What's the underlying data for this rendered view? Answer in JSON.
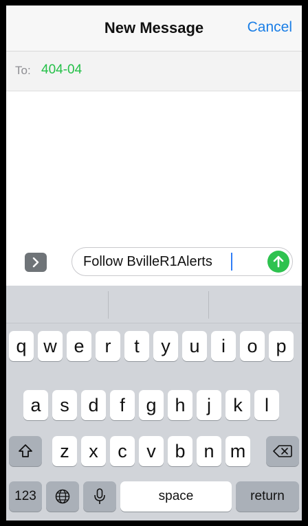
{
  "header": {
    "title": "New Message",
    "cancel_label": "Cancel"
  },
  "recipient": {
    "label": "To:",
    "value": "404-04"
  },
  "composer": {
    "text": "Follow BvilleR1Alerts"
  },
  "keyboard": {
    "row1": [
      "q",
      "w",
      "e",
      "r",
      "t",
      "y",
      "u",
      "i",
      "o",
      "p"
    ],
    "row2": [
      "a",
      "s",
      "d",
      "f",
      "g",
      "h",
      "j",
      "k",
      "l"
    ],
    "row3": [
      "z",
      "x",
      "c",
      "v",
      "b",
      "n",
      "m"
    ],
    "numbers_label": "123",
    "space_label": "space",
    "return_label": "return"
  },
  "colors": {
    "accent": "#1a7ee6",
    "recipient": "#24c048",
    "send": "#2ec24f"
  },
  "icons": {
    "expand": "chevron-right-icon",
    "send": "arrow-up-icon",
    "shift": "shift-icon",
    "delete": "backspace-icon",
    "globe": "globe-icon",
    "mic": "microphone-icon"
  }
}
